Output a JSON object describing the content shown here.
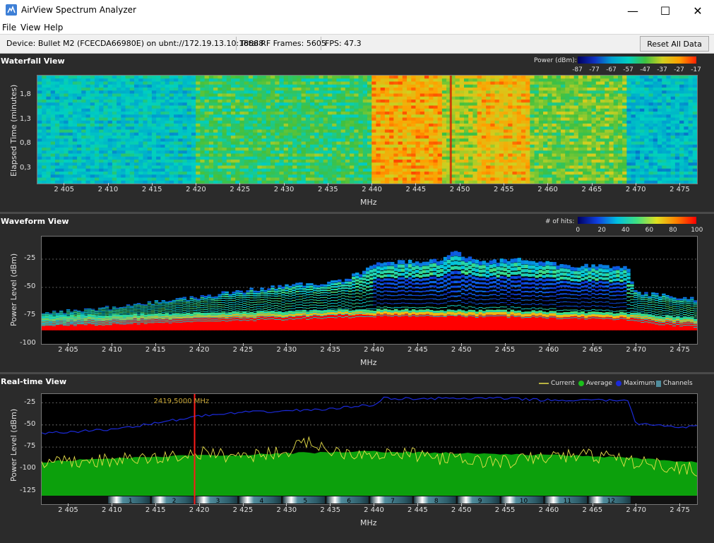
{
  "window": {
    "title": "AirView Spectrum Analyzer"
  },
  "menu": {
    "file": "File",
    "view": "View",
    "help": "Help"
  },
  "info": {
    "device": "Device: Bullet M2 (FCECDA66980E) on ubnt://172.19.13.10:18888",
    "frames": "Total RF Frames: 5605",
    "fps": "FPS: 47.3",
    "reset": "Reset All Data"
  },
  "colors": {
    "accent_marker": "#ff1a1a",
    "current": "#e8e04a",
    "average": "#1bbf1b",
    "maximum": "#1b2ad8",
    "channels": "#4f8c9c"
  },
  "x_axis": {
    "label": "MHz",
    "ticks": [
      "2 405",
      "2 410",
      "2 415",
      "2 420",
      "2 425",
      "2 430",
      "2 435",
      "2 440",
      "2 445",
      "2 450",
      "2 455",
      "2 460",
      "2 465",
      "2 470",
      "2 475"
    ]
  },
  "waterfall": {
    "title": "Waterfall View",
    "ylabel": "Elapsed Time (minutes)",
    "yticks": [
      "1,8",
      "1,3",
      "0,8",
      "0,3"
    ],
    "legend_label": "Power (dBm):",
    "legend_ticks": [
      "-87",
      "-77",
      "-67",
      "-57",
      "-47",
      "-37",
      "-27",
      "-17"
    ]
  },
  "waveform": {
    "title": "Waveform View",
    "ylabel": "Power Level (dBm)",
    "yticks": [
      "-25",
      "-50",
      "-75",
      "-100"
    ],
    "legend_label": "# of hits:",
    "legend_ticks": [
      "0",
      "20",
      "40",
      "60",
      "80",
      "100"
    ]
  },
  "realtime": {
    "title": "Real-time View",
    "ylabel": "Power Level (dBm)",
    "yticks": [
      "-25",
      "-50",
      "-75",
      "-100",
      "-125"
    ],
    "marker_label": "2419,5000 MHz",
    "legend": {
      "current": "Current",
      "average": "Average",
      "maximum": "Maximum",
      "channels": "Channels"
    },
    "channels": [
      "1",
      "2",
      "3",
      "4",
      "5",
      "6",
      "7",
      "8",
      "9",
      "10",
      "11",
      "12"
    ]
  },
  "chart_data": [
    {
      "type": "heatmap",
      "title": "Waterfall View",
      "xlabel": "MHz",
      "ylabel": "Elapsed Time (minutes)",
      "xlim": [
        2402,
        2477
      ],
      "ylim": [
        0,
        2.2
      ],
      "color_scale_dbm": [
        -87,
        -17
      ],
      "band_power_dbm": [
        {
          "from": 2402,
          "to": 2420,
          "value": -60
        },
        {
          "from": 2420,
          "to": 2440,
          "value": -50
        },
        {
          "from": 2440,
          "to": 2448,
          "value": -30
        },
        {
          "from": 2448,
          "to": 2452,
          "value": -40
        },
        {
          "from": 2452,
          "to": 2458,
          "value": -32
        },
        {
          "from": 2458,
          "to": 2469,
          "value": -45
        },
        {
          "from": 2469,
          "to": 2477,
          "value": -62
        }
      ]
    },
    {
      "type": "heatmap",
      "title": "Waveform View",
      "xlabel": "MHz",
      "ylabel": "Power Level (dBm)",
      "xlim": [
        2402,
        2477
      ],
      "ylim": [
        -100,
        -5
      ],
      "hits_scale": [
        0,
        100
      ],
      "noise_floor_dbm": [
        {
          "x": 2402,
          "y": -80
        },
        {
          "x": 2420,
          "y": -77
        },
        {
          "x": 2440,
          "y": -74
        },
        {
          "x": 2455,
          "y": -75
        },
        {
          "x": 2469,
          "y": -77
        },
        {
          "x": 2477,
          "y": -82
        }
      ],
      "signal_upper_envelope_dbm": [
        {
          "x": 2402,
          "y": -73
        },
        {
          "x": 2410,
          "y": -68
        },
        {
          "x": 2420,
          "y": -58
        },
        {
          "x": 2430,
          "y": -48
        },
        {
          "x": 2436,
          "y": -45
        },
        {
          "x": 2441,
          "y": -28
        },
        {
          "x": 2448,
          "y": -26
        },
        {
          "x": 2449,
          "y": -18
        },
        {
          "x": 2452,
          "y": -28
        },
        {
          "x": 2457,
          "y": -24
        },
        {
          "x": 2461,
          "y": -30
        },
        {
          "x": 2469,
          "y": -32
        },
        {
          "x": 2470,
          "y": -55
        },
        {
          "x": 2477,
          "y": -60
        }
      ]
    },
    {
      "type": "line",
      "title": "Real-time View",
      "xlabel": "MHz",
      "ylabel": "Power Level (dBm)",
      "xlim": [
        2402,
        2477
      ],
      "ylim": [
        -130,
        -15
      ],
      "marker_mhz": 2419.5,
      "series": [
        {
          "name": "Current",
          "x": [
            2402,
            2405,
            2410,
            2415,
            2420,
            2425,
            2430,
            2433,
            2435,
            2440,
            2445,
            2450,
            2455,
            2460,
            2465,
            2470,
            2475,
            2477
          ],
          "values": [
            -95,
            -92,
            -90,
            -88,
            -82,
            -85,
            -80,
            -68,
            -80,
            -82,
            -84,
            -90,
            -92,
            -86,
            -84,
            -92,
            -98,
            -100
          ]
        },
        {
          "name": "Average",
          "x": [
            2402,
            2405,
            2410,
            2415,
            2420,
            2425,
            2430,
            2435,
            2440,
            2445,
            2450,
            2455,
            2460,
            2465,
            2470,
            2475,
            2477
          ],
          "values": [
            -92,
            -90,
            -88,
            -86,
            -84,
            -84,
            -82,
            -81,
            -80,
            -81,
            -82,
            -83,
            -84,
            -85,
            -88,
            -91,
            -92
          ]
        },
        {
          "name": "Maximum",
          "x": [
            2402,
            2405,
            2410,
            2415,
            2420,
            2425,
            2430,
            2435,
            2440,
            2441,
            2445,
            2450,
            2455,
            2460,
            2465,
            2469,
            2470,
            2475,
            2477
          ],
          "values": [
            -60,
            -58,
            -55,
            -48,
            -40,
            -36,
            -34,
            -32,
            -27,
            -20,
            -20,
            -20,
            -20,
            -22,
            -22,
            -22,
            -48,
            -52,
            -52
          ]
        }
      ],
      "channels": [
        {
          "name": "1",
          "center": 2412
        },
        {
          "name": "2",
          "center": 2417
        },
        {
          "name": "3",
          "center": 2422
        },
        {
          "name": "4",
          "center": 2427
        },
        {
          "name": "5",
          "center": 2432
        },
        {
          "name": "6",
          "center": 2437
        },
        {
          "name": "7",
          "center": 2442
        },
        {
          "name": "8",
          "center": 2447
        },
        {
          "name": "9",
          "center": 2452
        },
        {
          "name": "10",
          "center": 2457
        },
        {
          "name": "11",
          "center": 2462
        },
        {
          "name": "12",
          "center": 2467
        }
      ]
    }
  ]
}
